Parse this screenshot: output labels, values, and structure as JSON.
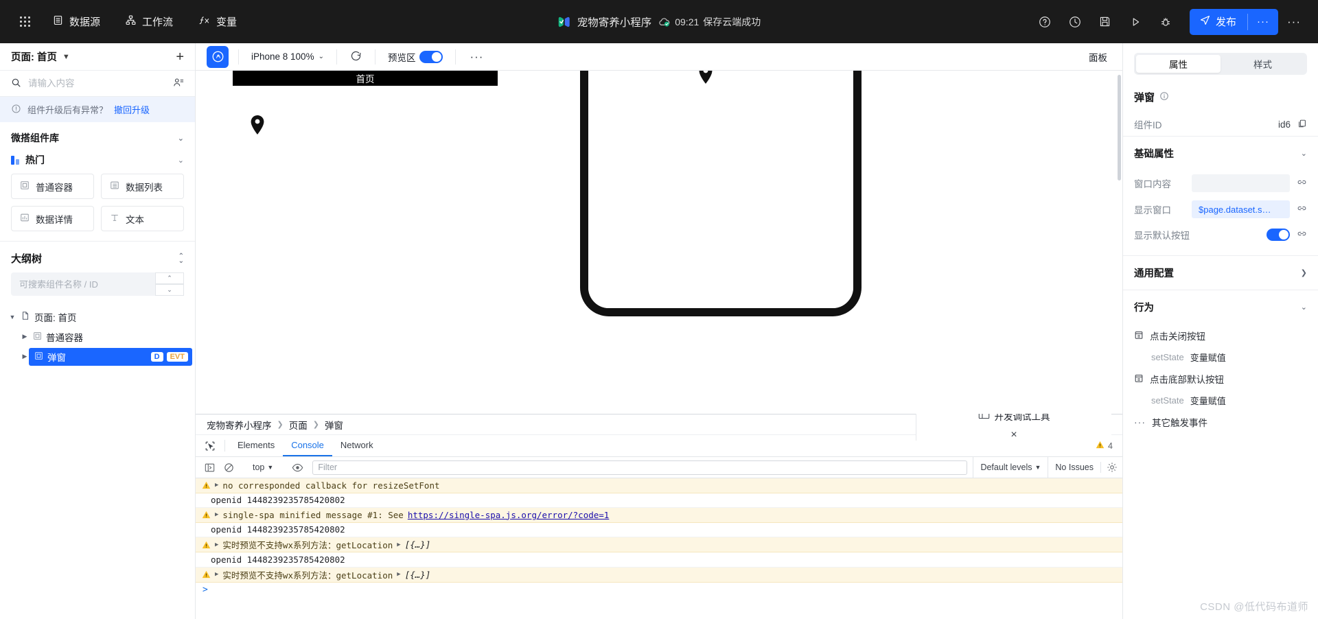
{
  "topbar": {
    "menu": [
      {
        "label": "数据源",
        "icon": "database-icon"
      },
      {
        "label": "工作流",
        "icon": "workflow-icon"
      },
      {
        "label": "变量",
        "icon": "fx-icon"
      }
    ],
    "app_title": "宠物寄养小程序",
    "save_time": "09:21",
    "save_status": "保存云端成功",
    "icons": [
      "help-icon",
      "history-icon",
      "save-icon",
      "preview-run-icon",
      "debug-bug-icon"
    ],
    "publish_label": "发布",
    "publish_more": "···",
    "more": "···",
    "accent": "#1A66FF"
  },
  "left": {
    "page_label": "页面: 首页",
    "add_label": "+",
    "search_placeholder": "请输入内容",
    "notice_text": "组件升级后有异常？",
    "notice_action": "撤回升级",
    "library_title": "微搭组件库",
    "category": "热门",
    "components": [
      {
        "label": "普通容器",
        "icon": "container-icon"
      },
      {
        "label": "数据列表",
        "icon": "list-icon"
      },
      {
        "label": "数据详情",
        "icon": "detail-icon"
      },
      {
        "label": "文本",
        "icon": "text-icon"
      }
    ],
    "outline_title": "大纲树",
    "outline_placeholder": "可搜索组件名称 / ID",
    "tree": [
      {
        "label": "页面: 首页",
        "level": 1,
        "expanded": true,
        "selected": false
      },
      {
        "label": "普通容器",
        "level": 2,
        "expanded": false,
        "selected": false
      },
      {
        "label": "弹窗",
        "level": 2,
        "expanded": false,
        "selected": true,
        "badges": [
          "D",
          "EVT"
        ]
      }
    ]
  },
  "center": {
    "device": "iPhone 8 100%",
    "refresh_icon": "refresh-icon",
    "preview_label": "预览区",
    "preview_on": true,
    "more": "···",
    "panel_label": "面板",
    "page_title": "首页"
  },
  "devtools": {
    "breadcrumb": [
      "宠物寄养小程序",
      "页面",
      "弹窗"
    ],
    "tool_label": "开发调试工具",
    "close": "×",
    "tabs": [
      {
        "label": "Elements",
        "active": false
      },
      {
        "label": "Console",
        "active": true
      },
      {
        "label": "Network",
        "active": false
      }
    ],
    "warn_count": "4",
    "context": "top",
    "filter_placeholder": "Filter",
    "levels": "Default levels",
    "issues": "No Issues",
    "logs": [
      {
        "type": "warn",
        "expandable": true,
        "text": "no corresponded callback for resizeSetFont"
      },
      {
        "type": "plain",
        "expandable": false,
        "text": "openid 1448239235785420802"
      },
      {
        "type": "warn",
        "expandable": true,
        "text": "single-spa minified message #1: See ",
        "link": "https://single-spa.js.org/error/?code=1"
      },
      {
        "type": "plain",
        "expandable": false,
        "text": "openid 1448239235785420802"
      },
      {
        "type": "warn",
        "expandable": true,
        "text": "实时预览不支持wx系列方法：getLocation",
        "object": "[{…}]"
      },
      {
        "type": "plain",
        "expandable": false,
        "text": "openid 1448239235785420802"
      },
      {
        "type": "warn",
        "expandable": true,
        "text": "实时预览不支持wx系列方法：getLocation",
        "object": "[{…}]"
      }
    ],
    "prompt": ">"
  },
  "right": {
    "tabs": [
      {
        "label": "属性",
        "active": true
      },
      {
        "label": "样式",
        "active": false
      }
    ],
    "component_title": "弹窗",
    "id_label": "组件ID",
    "id_value": "id6",
    "basic_section": "基础属性",
    "fields": [
      {
        "label": "窗口内容",
        "value": "",
        "bound": false
      },
      {
        "label": "显示窗口",
        "value": "$page.dataset.s…",
        "bound": true
      }
    ],
    "toggle_label": "显示默认按钮",
    "toggle_on": true,
    "common_section": "通用配置",
    "behavior_section": "行为",
    "events": [
      {
        "label": "点击关闭按钮",
        "action_key": "setState",
        "action_value": "变量赋值"
      },
      {
        "label": "点击底部默认按钮",
        "action_key": "setState",
        "action_value": "变量赋值"
      }
    ],
    "other_events": "其它触发事件"
  },
  "watermark": "CSDN @低代码布道师"
}
